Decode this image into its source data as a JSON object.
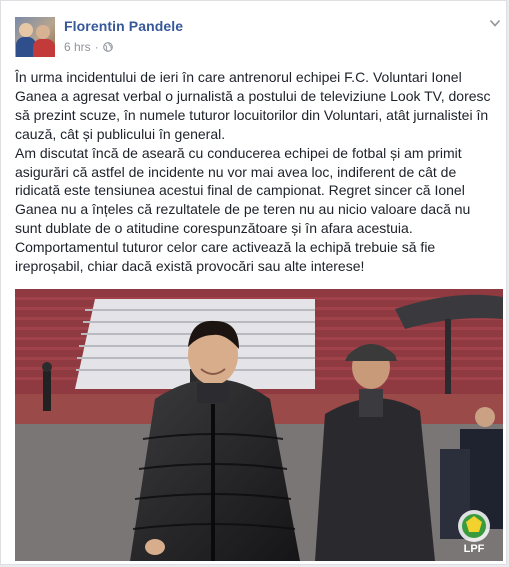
{
  "post": {
    "author": "Florentin Pandele",
    "time": "6 hrs",
    "separator": "·",
    "text": "În urma incidentului de ieri în care antrenorul echipei F.C. Voluntari Ionel Ganea a agresat verbal o jurnalistă a postului de televiziune Look TV, doresc să prezint scuze, în numele tuturor locuitorilor din Voluntari, atât jurnalistei în cauză, cât și publicului în general.\nAm discutat încă de aseară cu conducerea echipei de fotbal și am primit asigurări că astfel de incidente nu vor mai avea loc, indiferent de cât de ridicată este tensiunea acestui final de campionat. Regret sincer că Ionel Ganea nu a înțeles că rezultatele de pe teren nu au nicio valoare dacă nu sunt dublate de o atitudine corespunzătoare și în afara acestuia. Comportamentul tuturor celor care activează la echipă trebuie să fie ireproșabil, chiar dacă există provocări sau alte interese!",
    "photo_badge": "LPF"
  },
  "icons": {
    "privacy": "globe-icon",
    "options": "chevron-down-icon"
  },
  "colors": {
    "author_link": "#365899",
    "meta_gray": "#90949c",
    "text": "#1d2129",
    "border": "#dddfe2"
  }
}
